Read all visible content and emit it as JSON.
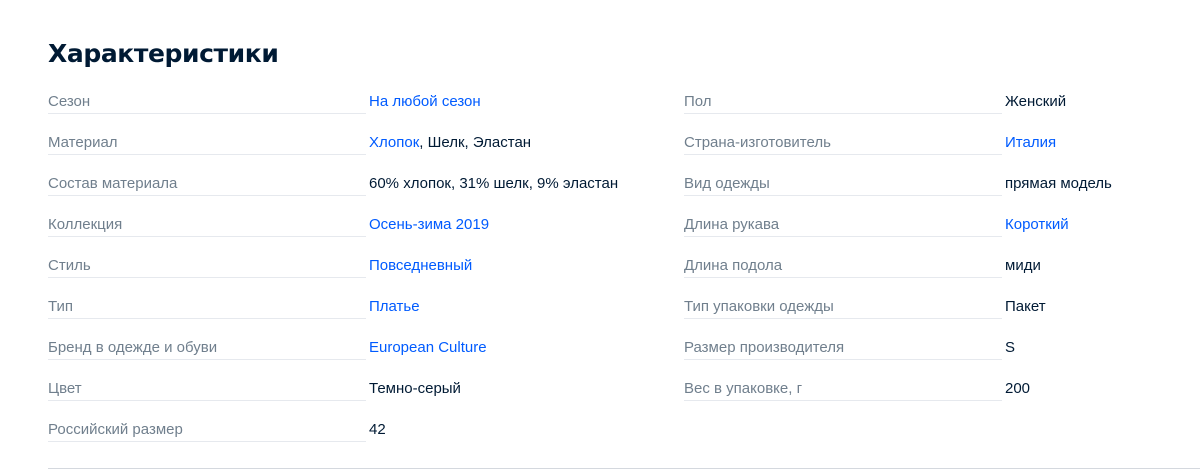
{
  "section": {
    "title": "Характеристики"
  },
  "left": [
    {
      "label": "Сезон",
      "value": [
        {
          "text": "На любой сезон",
          "link": true
        }
      ]
    },
    {
      "label": "Материал",
      "value": [
        {
          "text": "Хлопок",
          "link": true
        },
        {
          "text": ", Шелк, Эластан",
          "link": false
        }
      ]
    },
    {
      "label": "Состав материала",
      "value": [
        {
          "text": "60% хлопок, 31% шелк, 9% эластан",
          "link": false
        }
      ]
    },
    {
      "label": "Коллекция",
      "value": [
        {
          "text": "Осень-зима 2019",
          "link": true
        }
      ]
    },
    {
      "label": "Стиль",
      "value": [
        {
          "text": "Повседневный",
          "link": true
        }
      ]
    },
    {
      "label": "Тип",
      "value": [
        {
          "text": "Платье",
          "link": true
        }
      ]
    },
    {
      "label": "Бренд в одежде и обуви",
      "value": [
        {
          "text": "European Culture",
          "link": true
        }
      ]
    },
    {
      "label": "Цвет",
      "value": [
        {
          "text": "Темно-серый",
          "link": false
        }
      ]
    },
    {
      "label": "Российский размер",
      "value": [
        {
          "text": "42",
          "link": false
        }
      ]
    }
  ],
  "right": [
    {
      "label": "Пол",
      "value": [
        {
          "text": "Женский",
          "link": false
        }
      ]
    },
    {
      "label": "Страна-изготовитель",
      "value": [
        {
          "text": "Италия",
          "link": true
        }
      ]
    },
    {
      "label": "Вид одежды",
      "value": [
        {
          "text": "прямая модель",
          "link": false
        }
      ]
    },
    {
      "label": "Длина рукава",
      "value": [
        {
          "text": "Короткий",
          "link": true
        }
      ]
    },
    {
      "label": "Длина подола",
      "value": [
        {
          "text": "миди",
          "link": false
        }
      ]
    },
    {
      "label": "Тип упаковки одежды",
      "value": [
        {
          "text": "Пакет",
          "link": false
        }
      ]
    },
    {
      "label": "Размер производителя",
      "value": [
        {
          "text": "S",
          "link": false
        }
      ]
    },
    {
      "label": "Вес в упаковке, г",
      "value": [
        {
          "text": "200",
          "link": false
        }
      ]
    }
  ],
  "colors": {
    "link": "#005bff",
    "label": "#707f8d",
    "text": "#001a34"
  }
}
